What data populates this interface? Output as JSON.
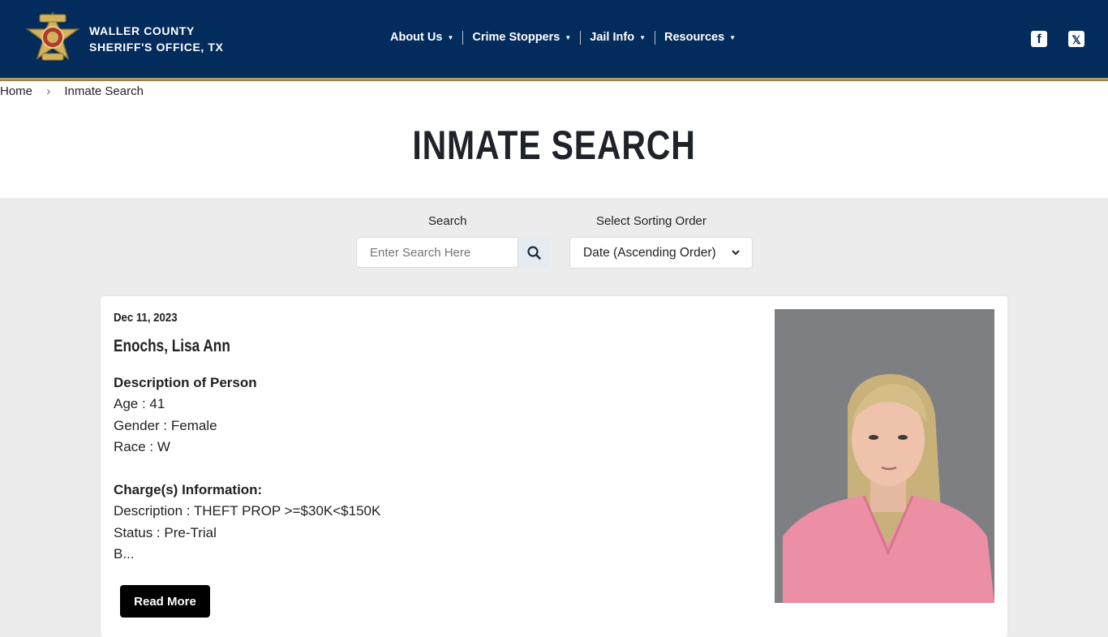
{
  "header": {
    "brand_line1": "WALLER COUNTY",
    "brand_line2": "SHERIFF'S OFFICE, TX",
    "nav": [
      {
        "label": "About Us"
      },
      {
        "label": "Crime Stoppers"
      },
      {
        "label": "Jail Info"
      },
      {
        "label": "Resources"
      }
    ],
    "social": [
      {
        "icon": "facebook-icon",
        "glyph": "f"
      },
      {
        "icon": "x-icon",
        "glyph": "𝕏"
      }
    ]
  },
  "breadcrumb": {
    "home": "Home",
    "current": "Inmate Search"
  },
  "page_title": "INMATE SEARCH",
  "controls": {
    "search_label": "Search",
    "search_placeholder": "Enter Search Here",
    "sort_label": "Select Sorting Order",
    "sort_selected": "Date (Ascending Order)"
  },
  "record": {
    "date": "Dec 11, 2023",
    "name": "Enochs, Lisa Ann",
    "desc_heading": "Description of Person",
    "age": "Age : 41",
    "gender": "Gender : Female",
    "race": "Race : W",
    "charges_heading": "Charge(s) Information:",
    "charge_desc": "Description : THEFT PROP >=$30K<$150K",
    "status": "Status : Pre-Trial",
    "truncated": "B...",
    "read_more": "Read More"
  },
  "colors": {
    "header_bg": "#032b5c",
    "accent_gold": "#c8ad6e",
    "page_bg": "#ececec"
  }
}
